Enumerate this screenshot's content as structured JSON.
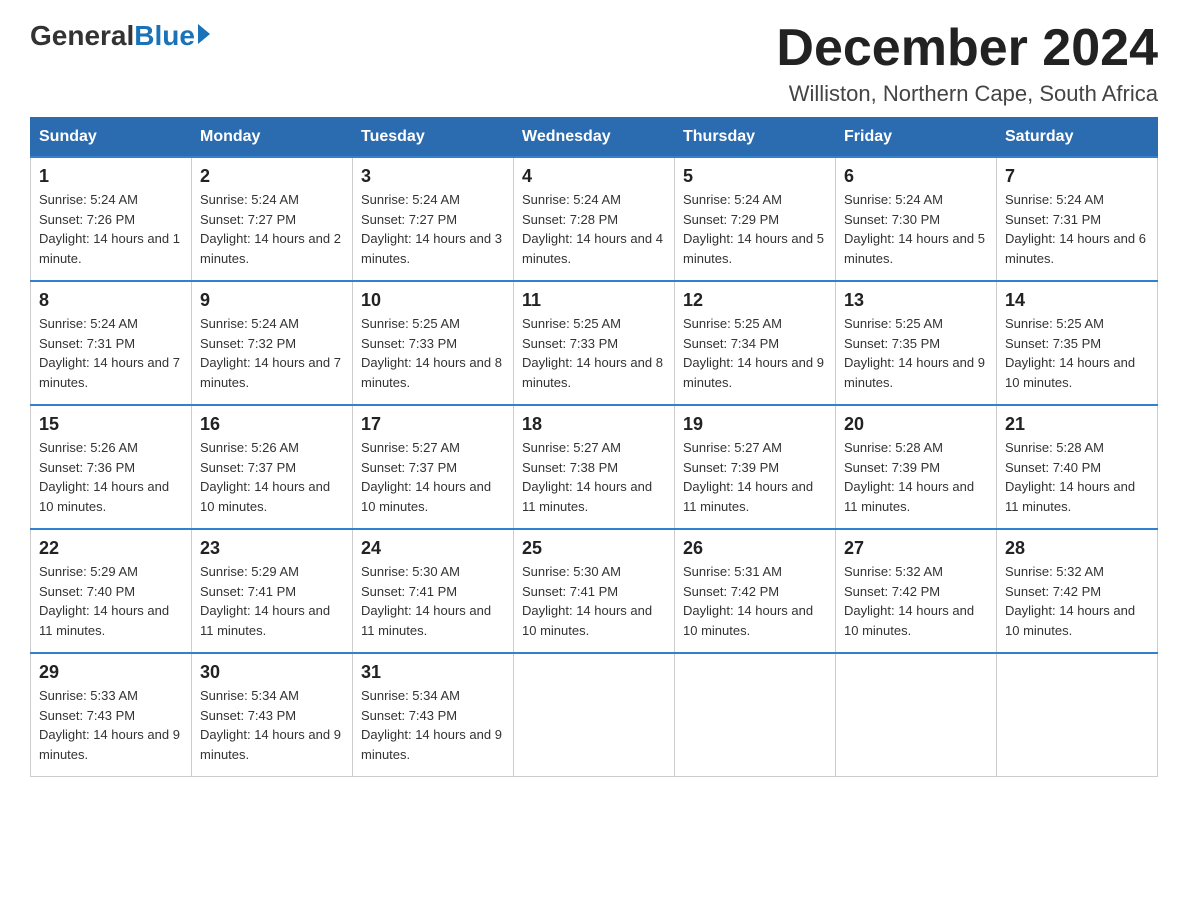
{
  "header": {
    "logo_general": "General",
    "logo_blue": "Blue",
    "month_title": "December 2024",
    "location": "Williston, Northern Cape, South Africa"
  },
  "days_of_week": [
    "Sunday",
    "Monday",
    "Tuesday",
    "Wednesday",
    "Thursday",
    "Friday",
    "Saturday"
  ],
  "weeks": [
    [
      {
        "day": "1",
        "sunrise": "5:24 AM",
        "sunset": "7:26 PM",
        "daylight": "14 hours and 1 minute."
      },
      {
        "day": "2",
        "sunrise": "5:24 AM",
        "sunset": "7:27 PM",
        "daylight": "14 hours and 2 minutes."
      },
      {
        "day": "3",
        "sunrise": "5:24 AM",
        "sunset": "7:27 PM",
        "daylight": "14 hours and 3 minutes."
      },
      {
        "day": "4",
        "sunrise": "5:24 AM",
        "sunset": "7:28 PM",
        "daylight": "14 hours and 4 minutes."
      },
      {
        "day": "5",
        "sunrise": "5:24 AM",
        "sunset": "7:29 PM",
        "daylight": "14 hours and 5 minutes."
      },
      {
        "day": "6",
        "sunrise": "5:24 AM",
        "sunset": "7:30 PM",
        "daylight": "14 hours and 5 minutes."
      },
      {
        "day": "7",
        "sunrise": "5:24 AM",
        "sunset": "7:31 PM",
        "daylight": "14 hours and 6 minutes."
      }
    ],
    [
      {
        "day": "8",
        "sunrise": "5:24 AM",
        "sunset": "7:31 PM",
        "daylight": "14 hours and 7 minutes."
      },
      {
        "day": "9",
        "sunrise": "5:24 AM",
        "sunset": "7:32 PM",
        "daylight": "14 hours and 7 minutes."
      },
      {
        "day": "10",
        "sunrise": "5:25 AM",
        "sunset": "7:33 PM",
        "daylight": "14 hours and 8 minutes."
      },
      {
        "day": "11",
        "sunrise": "5:25 AM",
        "sunset": "7:33 PM",
        "daylight": "14 hours and 8 minutes."
      },
      {
        "day": "12",
        "sunrise": "5:25 AM",
        "sunset": "7:34 PM",
        "daylight": "14 hours and 9 minutes."
      },
      {
        "day": "13",
        "sunrise": "5:25 AM",
        "sunset": "7:35 PM",
        "daylight": "14 hours and 9 minutes."
      },
      {
        "day": "14",
        "sunrise": "5:25 AM",
        "sunset": "7:35 PM",
        "daylight": "14 hours and 10 minutes."
      }
    ],
    [
      {
        "day": "15",
        "sunrise": "5:26 AM",
        "sunset": "7:36 PM",
        "daylight": "14 hours and 10 minutes."
      },
      {
        "day": "16",
        "sunrise": "5:26 AM",
        "sunset": "7:37 PM",
        "daylight": "14 hours and 10 minutes."
      },
      {
        "day": "17",
        "sunrise": "5:27 AM",
        "sunset": "7:37 PM",
        "daylight": "14 hours and 10 minutes."
      },
      {
        "day": "18",
        "sunrise": "5:27 AM",
        "sunset": "7:38 PM",
        "daylight": "14 hours and 11 minutes."
      },
      {
        "day": "19",
        "sunrise": "5:27 AM",
        "sunset": "7:39 PM",
        "daylight": "14 hours and 11 minutes."
      },
      {
        "day": "20",
        "sunrise": "5:28 AM",
        "sunset": "7:39 PM",
        "daylight": "14 hours and 11 minutes."
      },
      {
        "day": "21",
        "sunrise": "5:28 AM",
        "sunset": "7:40 PM",
        "daylight": "14 hours and 11 minutes."
      }
    ],
    [
      {
        "day": "22",
        "sunrise": "5:29 AM",
        "sunset": "7:40 PM",
        "daylight": "14 hours and 11 minutes."
      },
      {
        "day": "23",
        "sunrise": "5:29 AM",
        "sunset": "7:41 PM",
        "daylight": "14 hours and 11 minutes."
      },
      {
        "day": "24",
        "sunrise": "5:30 AM",
        "sunset": "7:41 PM",
        "daylight": "14 hours and 11 minutes."
      },
      {
        "day": "25",
        "sunrise": "5:30 AM",
        "sunset": "7:41 PM",
        "daylight": "14 hours and 10 minutes."
      },
      {
        "day": "26",
        "sunrise": "5:31 AM",
        "sunset": "7:42 PM",
        "daylight": "14 hours and 10 minutes."
      },
      {
        "day": "27",
        "sunrise": "5:32 AM",
        "sunset": "7:42 PM",
        "daylight": "14 hours and 10 minutes."
      },
      {
        "day": "28",
        "sunrise": "5:32 AM",
        "sunset": "7:42 PM",
        "daylight": "14 hours and 10 minutes."
      }
    ],
    [
      {
        "day": "29",
        "sunrise": "5:33 AM",
        "sunset": "7:43 PM",
        "daylight": "14 hours and 9 minutes."
      },
      {
        "day": "30",
        "sunrise": "5:34 AM",
        "sunset": "7:43 PM",
        "daylight": "14 hours and 9 minutes."
      },
      {
        "day": "31",
        "sunrise": "5:34 AM",
        "sunset": "7:43 PM",
        "daylight": "14 hours and 9 minutes."
      },
      null,
      null,
      null,
      null
    ]
  ],
  "labels": {
    "sunrise_prefix": "Sunrise: ",
    "sunset_prefix": "Sunset: ",
    "daylight_prefix": "Daylight: "
  }
}
